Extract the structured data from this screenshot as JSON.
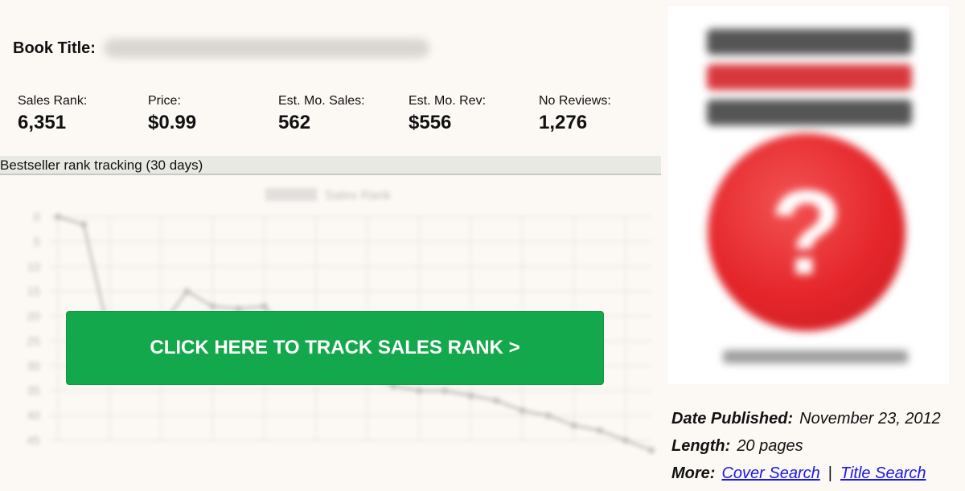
{
  "book": {
    "title_label": "Book Title:"
  },
  "stats": [
    {
      "label": "Sales Rank:",
      "value": "6,351"
    },
    {
      "label": "Price:",
      "value": "$0.99"
    },
    {
      "label": "Est. Mo. Sales:",
      "value": "562"
    },
    {
      "label": "Est. Mo. Rev:",
      "value": "$556"
    },
    {
      "label": "No Reviews:",
      "value": "1,276"
    }
  ],
  "chart_section": {
    "header": "Bestseller rank tracking (30 days)"
  },
  "cta": {
    "label": "CLICK HERE TO TRACK SALES RANK >"
  },
  "details": {
    "date_label": "Date Published:",
    "date_value": "November 23, 2012",
    "length_label": "Length:",
    "length_value": "20 pages",
    "more_label": "More:",
    "cover_search": "Cover Search",
    "separator": "|",
    "title_search": "Title Search"
  },
  "colors": {
    "cta_green": "#13a84b",
    "link_blue": "#1a1ae6",
    "cover_red": "#e5262b"
  },
  "chart_data": {
    "type": "line",
    "legend": [
      "Sales Rank"
    ],
    "y_ticks": [
      0,
      5,
      10,
      15,
      20,
      25,
      30,
      35,
      40,
      45
    ],
    "ylim": [
      0,
      45
    ],
    "y_reversed": true,
    "series": [
      {
        "name": "Sales Rank",
        "values": [
          0,
          1.5,
          24,
          27,
          22,
          15,
          18,
          18.5,
          18,
          24,
          28,
          30,
          32,
          34,
          35,
          35,
          36,
          37,
          39,
          40,
          42,
          43,
          45,
          47
        ]
      }
    ]
  }
}
